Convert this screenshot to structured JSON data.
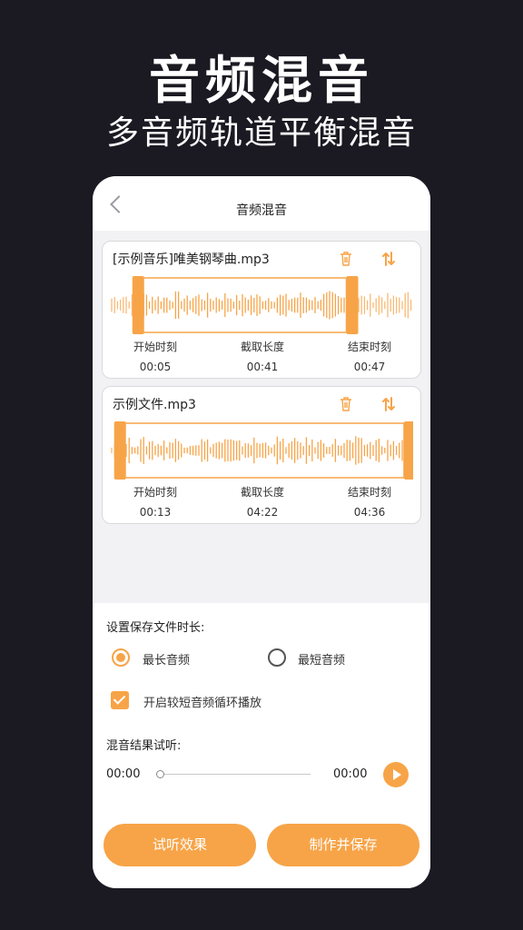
{
  "hero": {
    "title": "音频混音",
    "subtitle": "多音频轨道平衡混音"
  },
  "nav": {
    "title": "音频混音",
    "back_icon": "chevron-left-icon"
  },
  "accent_color": "#f7a448",
  "tracks": [
    {
      "filename": "[示例音乐]唯美钢琴曲.mp3",
      "start_label": "开始时刻",
      "start_value": "00:05",
      "length_label": "截取长度",
      "length_value": "00:41",
      "end_label": "结束时刻",
      "end_value": "00:47",
      "selection_start": 0.11,
      "selection_end": 0.78
    },
    {
      "filename": "示例文件.mp3",
      "start_label": "开始时刻",
      "start_value": "00:13",
      "length_label": "截取长度",
      "length_value": "04:22",
      "end_label": "结束时刻",
      "end_value": "04:36",
      "selection_start": 0.05,
      "selection_end": 0.97
    }
  ],
  "settings": {
    "duration_label": "设置保存文件时长:",
    "option_longest": "最长音频",
    "option_shortest": "最短音频",
    "selected_option": "最长音频",
    "loop_label": "开启较短音频循环播放",
    "loop_checked": true,
    "preview_label": "混音结果试听:",
    "current_time": "00:00",
    "total_time": "00:00",
    "progress": 0
  },
  "buttons": {
    "preview": "试听效果",
    "save": "制作并保存"
  }
}
